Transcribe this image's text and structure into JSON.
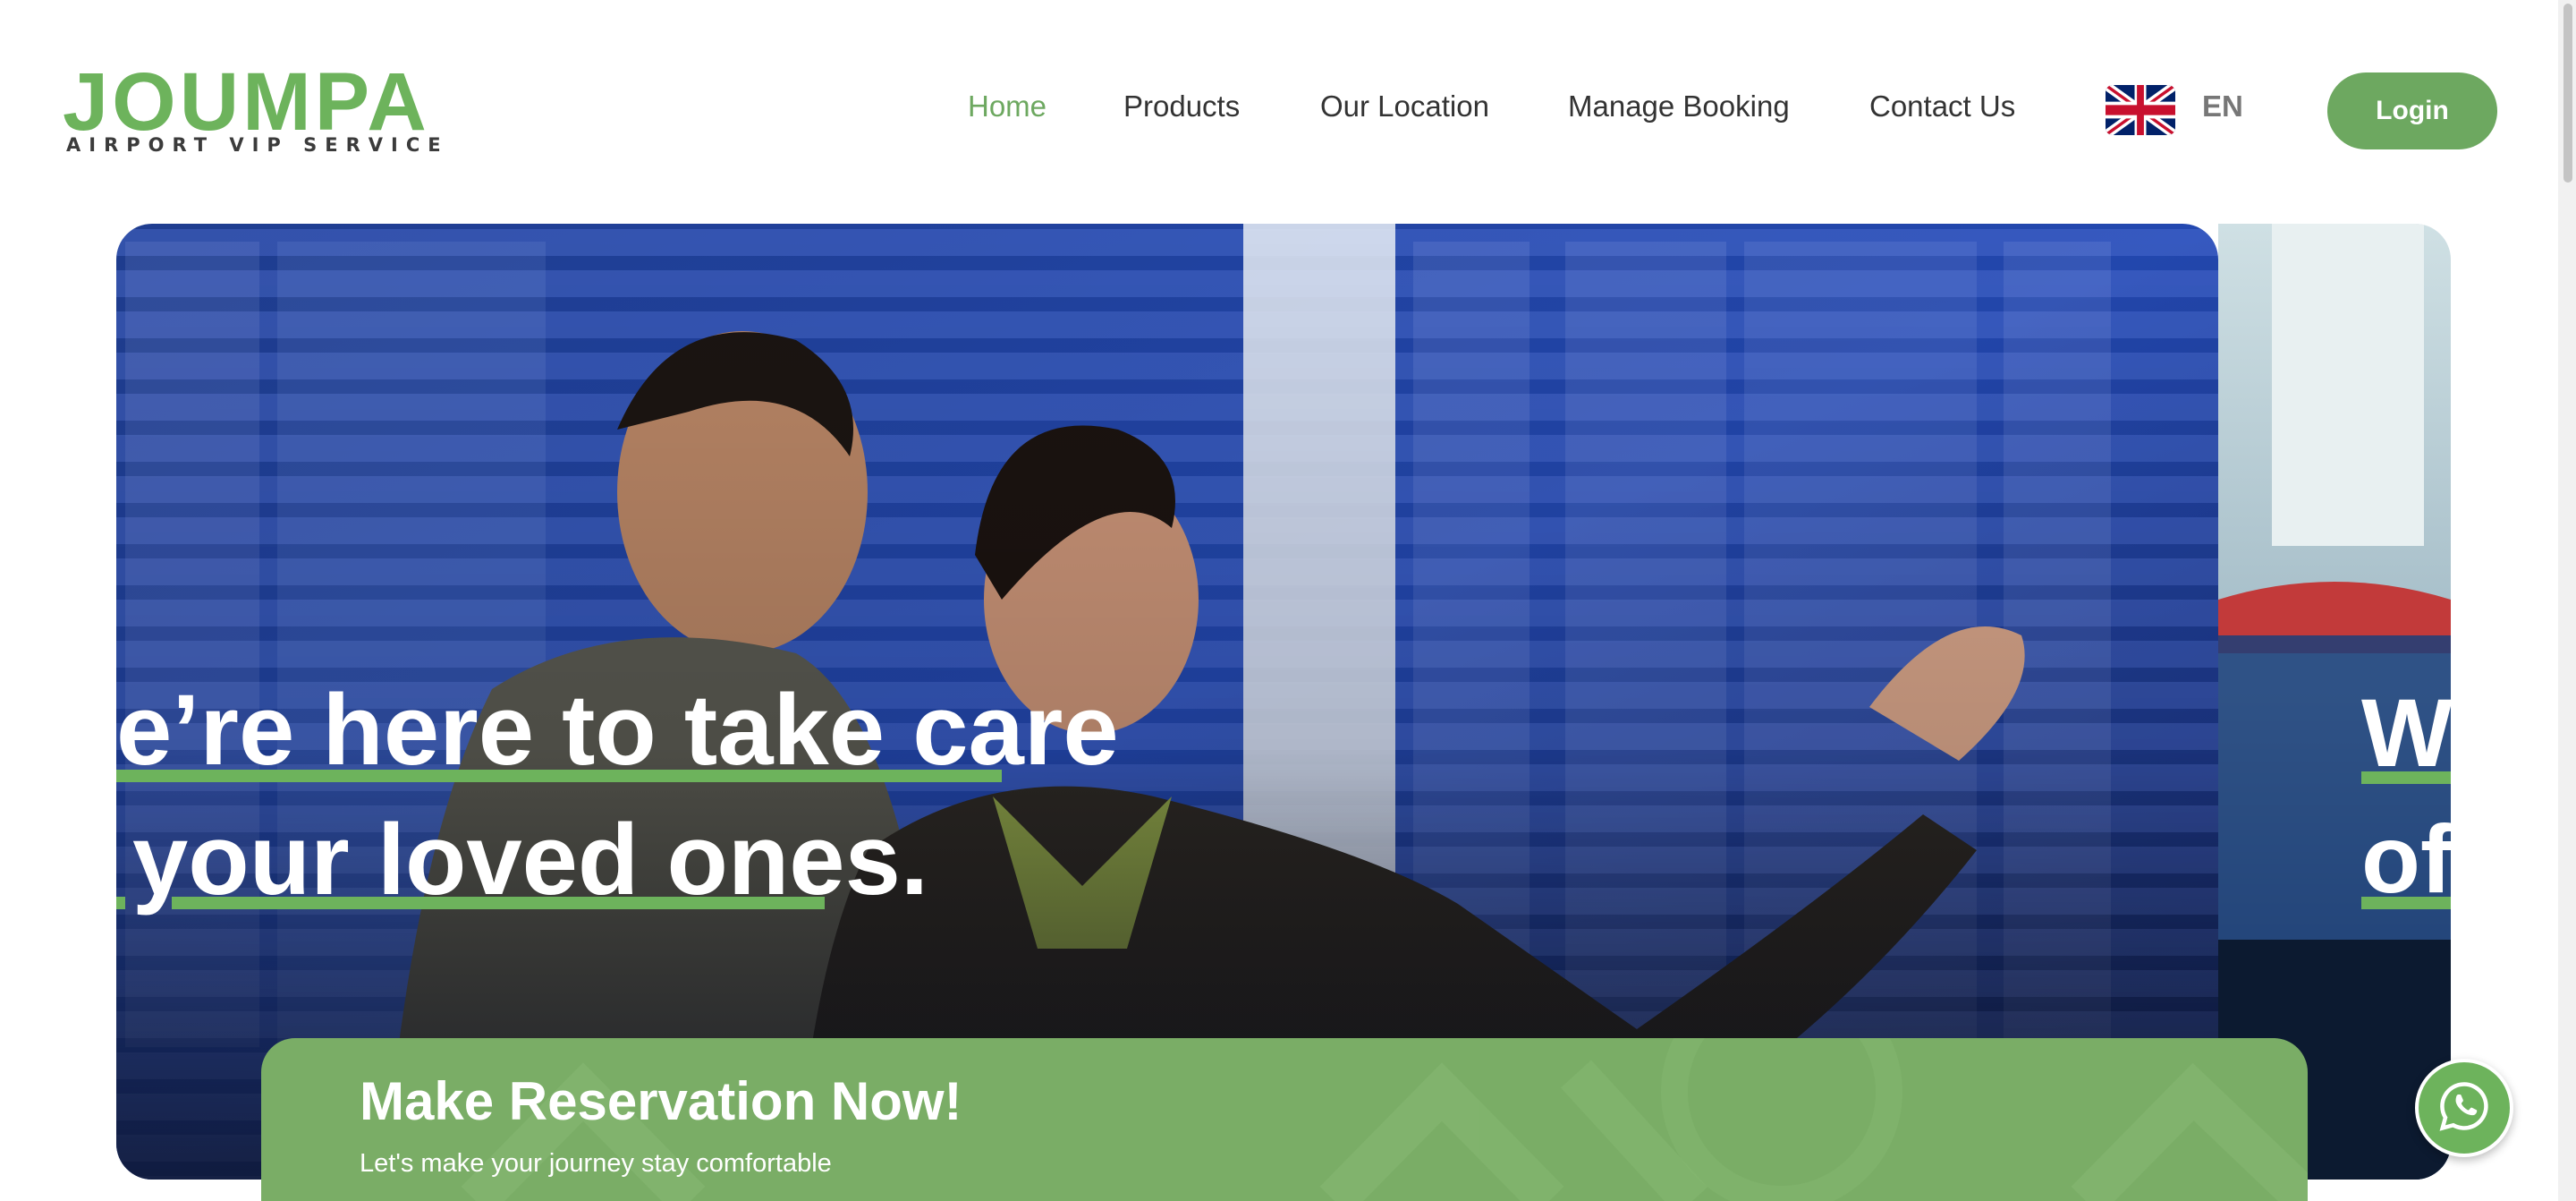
{
  "brand": {
    "name": "JOUMPA",
    "tagline": "AIRPORT VIP SERVICE"
  },
  "nav": {
    "items": [
      {
        "label": "Home",
        "active": true
      },
      {
        "label": "Products",
        "active": false
      },
      {
        "label": "Our Location",
        "active": false
      },
      {
        "label": "Manage Booking",
        "active": false
      },
      {
        "label": "Contact Us",
        "active": false
      }
    ],
    "language": "EN",
    "flag_icon": "uk-flag-icon",
    "login_label": "Login"
  },
  "hero": {
    "line1": "e’re here to take care",
    "line2": "your loved ones.",
    "next_line1": "W",
    "next_line2": "of"
  },
  "reservation": {
    "title": "Make Reservation Now!",
    "subtitle": "Let's make your journey stay comfortable"
  },
  "floating": {
    "whatsapp_icon": "whatsapp-icon"
  },
  "colors": {
    "accent": "#6db35c",
    "panel": "#7aad66",
    "nav_active": "#6da860"
  }
}
